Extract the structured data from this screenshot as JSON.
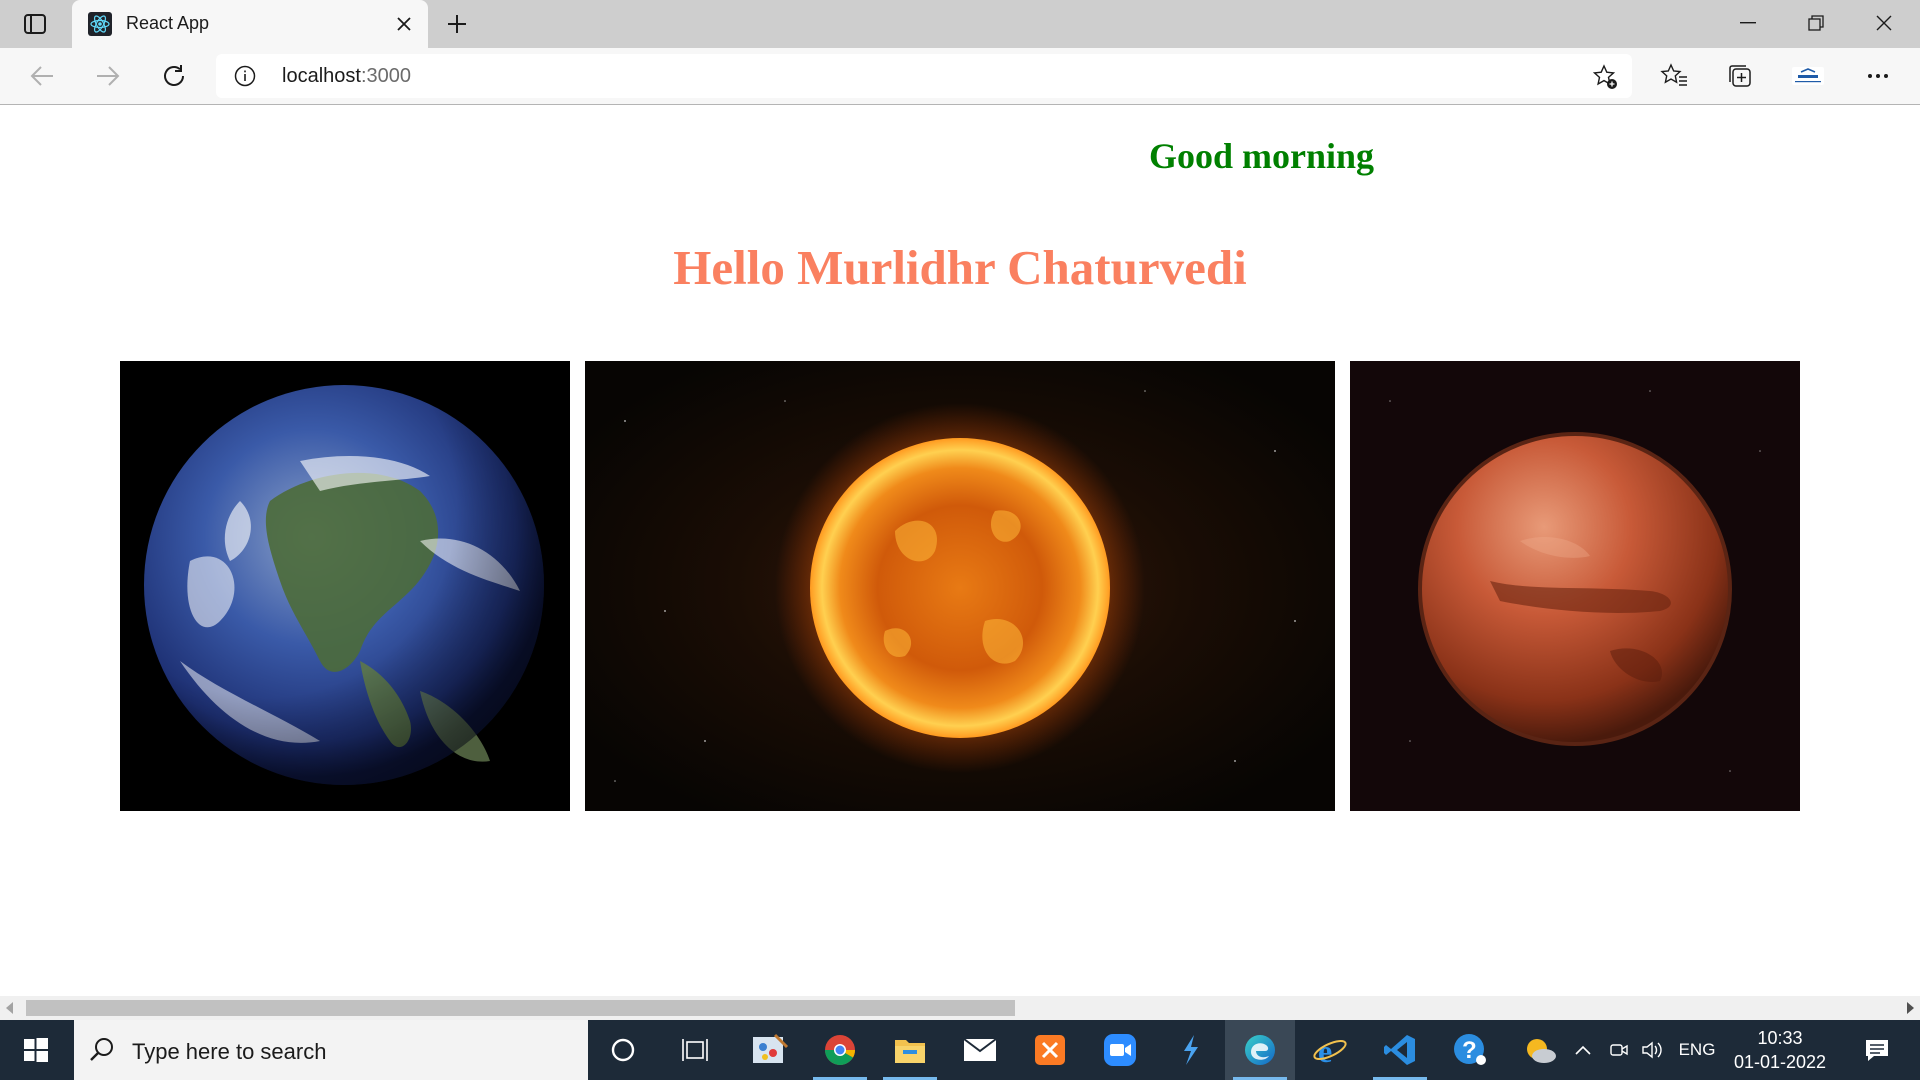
{
  "browser": {
    "tab_title": "React App",
    "url_host": "localhost",
    "url_port": ":3000"
  },
  "page": {
    "greeting": "Good morning",
    "hello": "Hello Murlidhr Chaturvedi",
    "images": [
      "earth-image",
      "sun-image",
      "mars-image"
    ]
  },
  "taskbar": {
    "search_placeholder": "Type here to search",
    "language": "ENG",
    "time": "10:33",
    "date": "01-01-2022",
    "apps": [
      "cortana",
      "task-view",
      "paint-app",
      "chrome",
      "file-explorer",
      "mail",
      "xampp",
      "zoom",
      "visual-studio",
      "edge",
      "internet-explorer",
      "vscode",
      "help",
      "weather"
    ]
  },
  "colors": {
    "greeting": "#008000",
    "hello": "#fa8060",
    "taskbar": "#1d2a38"
  }
}
